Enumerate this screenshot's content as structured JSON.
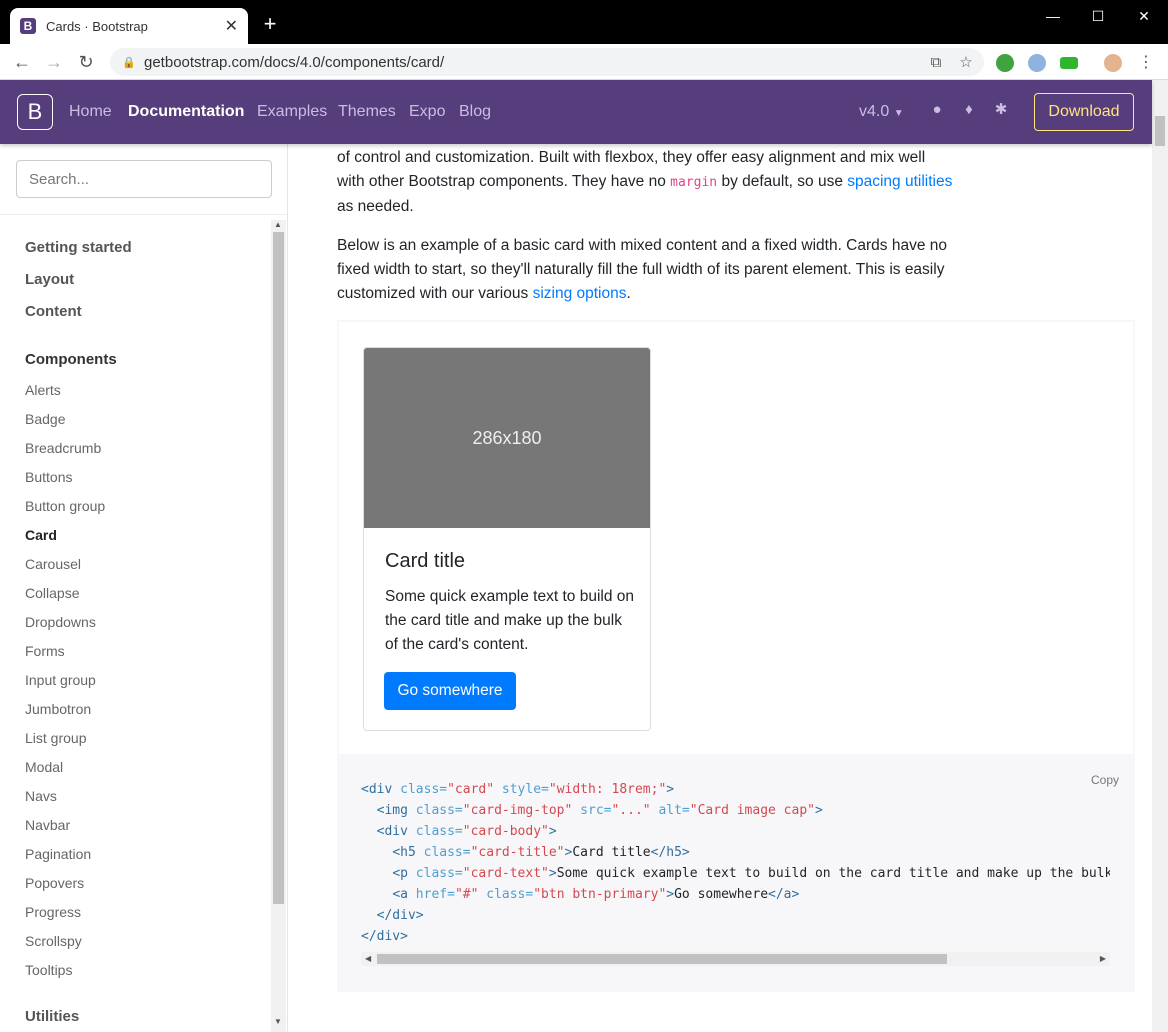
{
  "browser": {
    "tab_title": "Cards · Bootstrap",
    "tab_favicon": "B",
    "url": "getbootstrap.com/docs/4.0/components/card/"
  },
  "navbar": {
    "brand": "B",
    "links": [
      "Home",
      "Documentation",
      "Examples",
      "Themes",
      "Expo",
      "Blog"
    ],
    "version": "v4.0",
    "download": "Download",
    "colors": {
      "background": "#563d7c",
      "accent": "#ffe484"
    }
  },
  "sidebar": {
    "search_placeholder": "Search...",
    "sections": [
      "Getting started",
      "Layout",
      "Content",
      "Components",
      "Utilities"
    ],
    "components": [
      "Alerts",
      "Badge",
      "Breadcrumb",
      "Buttons",
      "Button group",
      "Card",
      "Carousel",
      "Collapse",
      "Dropdowns",
      "Forms",
      "Input group",
      "Jumbotron",
      "List group",
      "Modal",
      "Navs",
      "Navbar",
      "Pagination",
      "Popovers",
      "Progress",
      "Scrollspy",
      "Tooltips"
    ],
    "active": "Card"
  },
  "content": {
    "p1_a": "of control and customization. Built with flexbox, they offer easy alignment and mix well",
    "p1_b": "with other Bootstrap components. They have no ",
    "p1_code": "margin",
    "p1_c": " by default, so use ",
    "p1_link": "spacing utilities",
    "p1_d": "as needed.",
    "p2_a": "Below is an example of a basic card with mixed content and a fixed width. Cards have no",
    "p2_b": "fixed width to start, so they'll naturally fill the full width of its parent element. This is easily",
    "p2_c": "customized with our various ",
    "p2_link": "sizing options",
    "p2_d": "."
  },
  "card": {
    "image_text": "286x180",
    "title": "Card title",
    "text": "Some quick example text to build on the card title and make up the bulk of the card's content.",
    "button": "Go somewhere"
  },
  "code": {
    "copy": "Copy"
  }
}
